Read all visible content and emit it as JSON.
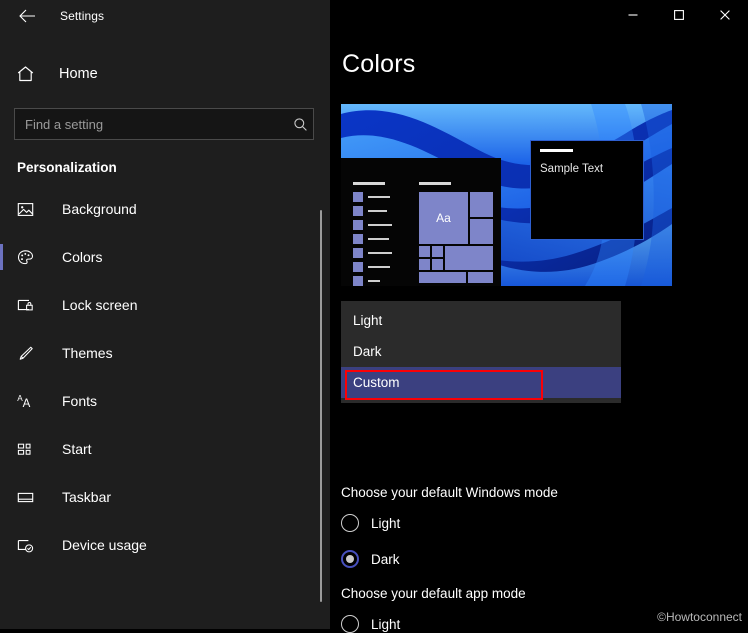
{
  "window": {
    "app_title": "Settings",
    "back_icon": "back-arrow-icon",
    "controls": {
      "minimize": "minimize-icon",
      "maximize": "maximize-icon",
      "close": "close-icon"
    }
  },
  "sidebar": {
    "home": {
      "label": "Home",
      "icon": "home-icon"
    },
    "search": {
      "placeholder": "Find a setting",
      "value": "",
      "icon": "search-icon"
    },
    "section_title": "Personalization",
    "items": [
      {
        "label": "Background",
        "icon": "image-icon",
        "selected": false
      },
      {
        "label": "Colors",
        "icon": "palette-icon",
        "selected": true
      },
      {
        "label": "Lock screen",
        "icon": "lock-screen-icon",
        "selected": false
      },
      {
        "label": "Themes",
        "icon": "brush-icon",
        "selected": false
      },
      {
        "label": "Fonts",
        "icon": "fonts-icon",
        "selected": false
      },
      {
        "label": "Start",
        "icon": "start-tiles-icon",
        "selected": false
      },
      {
        "label": "Taskbar",
        "icon": "taskbar-icon",
        "selected": false
      },
      {
        "label": "Device usage",
        "icon": "device-usage-icon",
        "selected": false
      }
    ]
  },
  "main": {
    "page_title": "Colors",
    "preview": {
      "sample_window_text": "Sample Text",
      "tile_text": "Aa"
    },
    "color_dropdown": {
      "expanded": true,
      "selected": "Custom",
      "options": [
        {
          "label": "Light",
          "selected": false
        },
        {
          "label": "Dark",
          "selected": false
        },
        {
          "label": "Custom",
          "selected": true
        }
      ],
      "highlight_annotation": "red-rectangle"
    },
    "windows_mode": {
      "label": "Choose your default Windows mode",
      "options": [
        {
          "label": "Light",
          "checked": false
        },
        {
          "label": "Dark",
          "checked": true
        }
      ]
    },
    "app_mode": {
      "label": "Choose your default app mode",
      "options": [
        {
          "label": "Light",
          "checked": false
        }
      ]
    }
  },
  "watermark": "©Howtoconnect",
  "colors": {
    "sidebar_bg": "#1e1e1e",
    "main_bg": "#000000",
    "accent": "#6c72c0",
    "dropdown_bg": "#2b2b2b",
    "dropdown_selected": "#3b4080",
    "annotation_red": "#fb0006",
    "radio_checked": "#4750bd",
    "preview_tile": "#7e85c9"
  }
}
